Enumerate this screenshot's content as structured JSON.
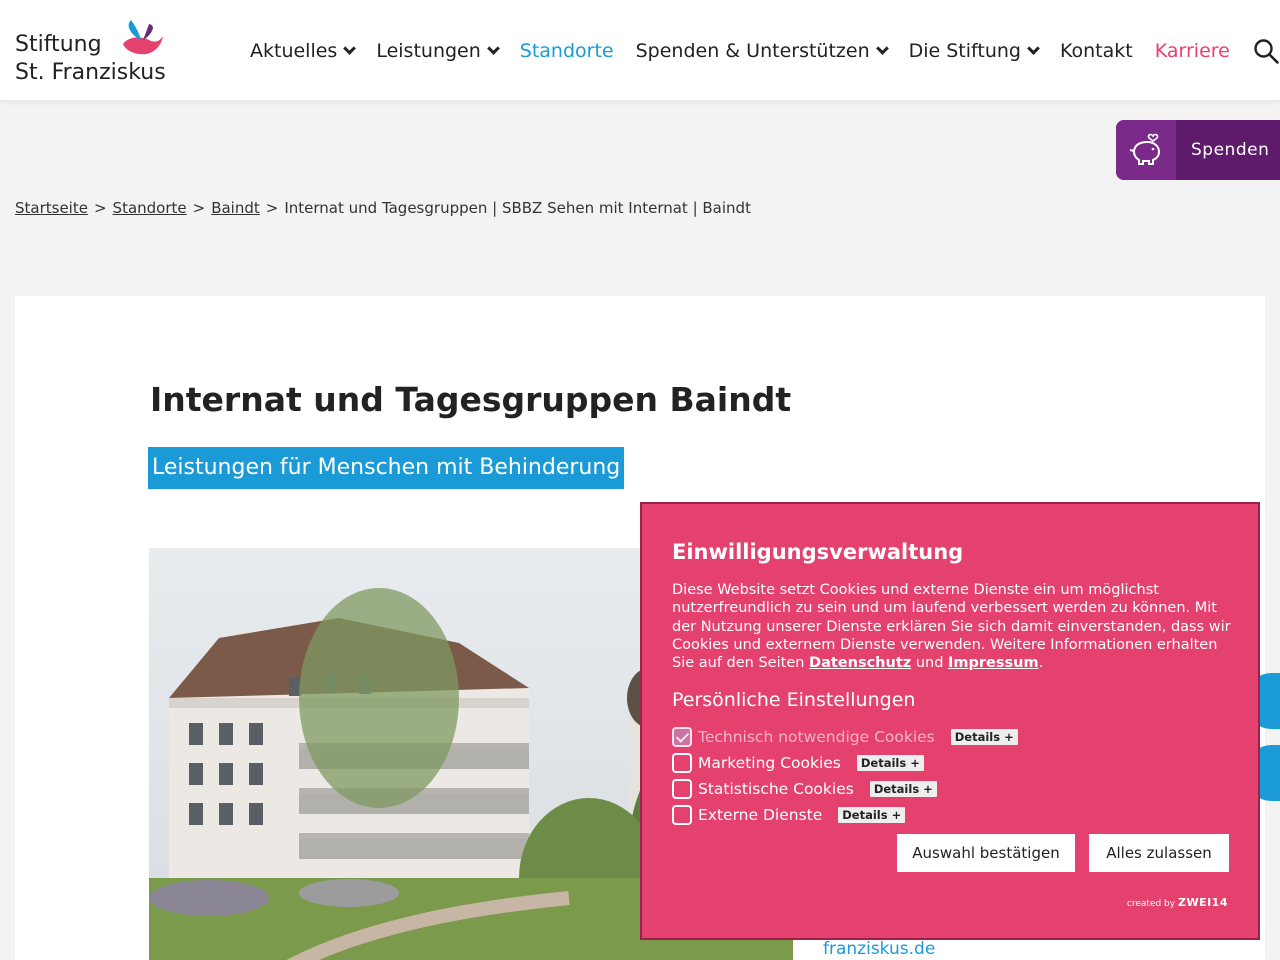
{
  "logo": {
    "line1": "Stiftung",
    "line2": "St. Franziskus"
  },
  "nav": {
    "items": [
      {
        "label": "Aktuelles",
        "dropdown": true
      },
      {
        "label": "Leistungen",
        "dropdown": true
      },
      {
        "label": "Standorte",
        "dropdown": false,
        "active": true
      },
      {
        "label": "Spenden & Unterstützen",
        "dropdown": true
      },
      {
        "label": "Die Stiftung",
        "dropdown": true
      },
      {
        "label": "Kontakt",
        "dropdown": false
      },
      {
        "label": "Karriere",
        "dropdown": false,
        "highlight": true
      }
    ]
  },
  "spenden": {
    "label": "Spenden"
  },
  "breadcrumb": {
    "items": [
      "Startseite",
      "Standorte",
      "Baindt"
    ],
    "current": "Internat und Tagesgruppen | SBBZ Sehen mit Internat | Baindt"
  },
  "page": {
    "title": "Internat und Tagesgruppen Baindt",
    "subtitle": "Leistungen für Menschen mit Behinderung",
    "link": "franziskus.de"
  },
  "cookie": {
    "title": "Einwilligungsverwaltung",
    "text_before": "Diese Website setzt Cookies und externe Dienste ein um möglichst nutzerfreundlich zu sein und um laufend verbessert werden zu können. Mit der Nutzung unserer Dienste erklären Sie sich damit einverstanden, dass wir Cookies und externem Dienste verwenden. Weitere Informationen erhalten Sie auf den Seiten",
    "link1": "Datenschutz",
    "and": "und",
    "link2": "Impressum",
    "settings_title": "Persönliche Einstellungen",
    "options": [
      {
        "label": "Technisch notwendige Cookies",
        "checked": true,
        "disabled": true,
        "details": "Details +"
      },
      {
        "label": "Marketing Cookies",
        "checked": false,
        "details": "Details +"
      },
      {
        "label": "Statistische Cookies",
        "checked": false,
        "details": "Details +"
      },
      {
        "label": "Externe Dienste",
        "checked": false,
        "details": "Details +"
      }
    ],
    "confirm_button": "Auswahl bestätigen",
    "accept_all_button": "Alles zulassen",
    "created_by": "created by",
    "created_brand": "ZWEI14"
  },
  "colors": {
    "brand_blue": "#1a9bd7",
    "brand_pink": "#e4416e",
    "spenden_purple": "#5e1a6b"
  }
}
